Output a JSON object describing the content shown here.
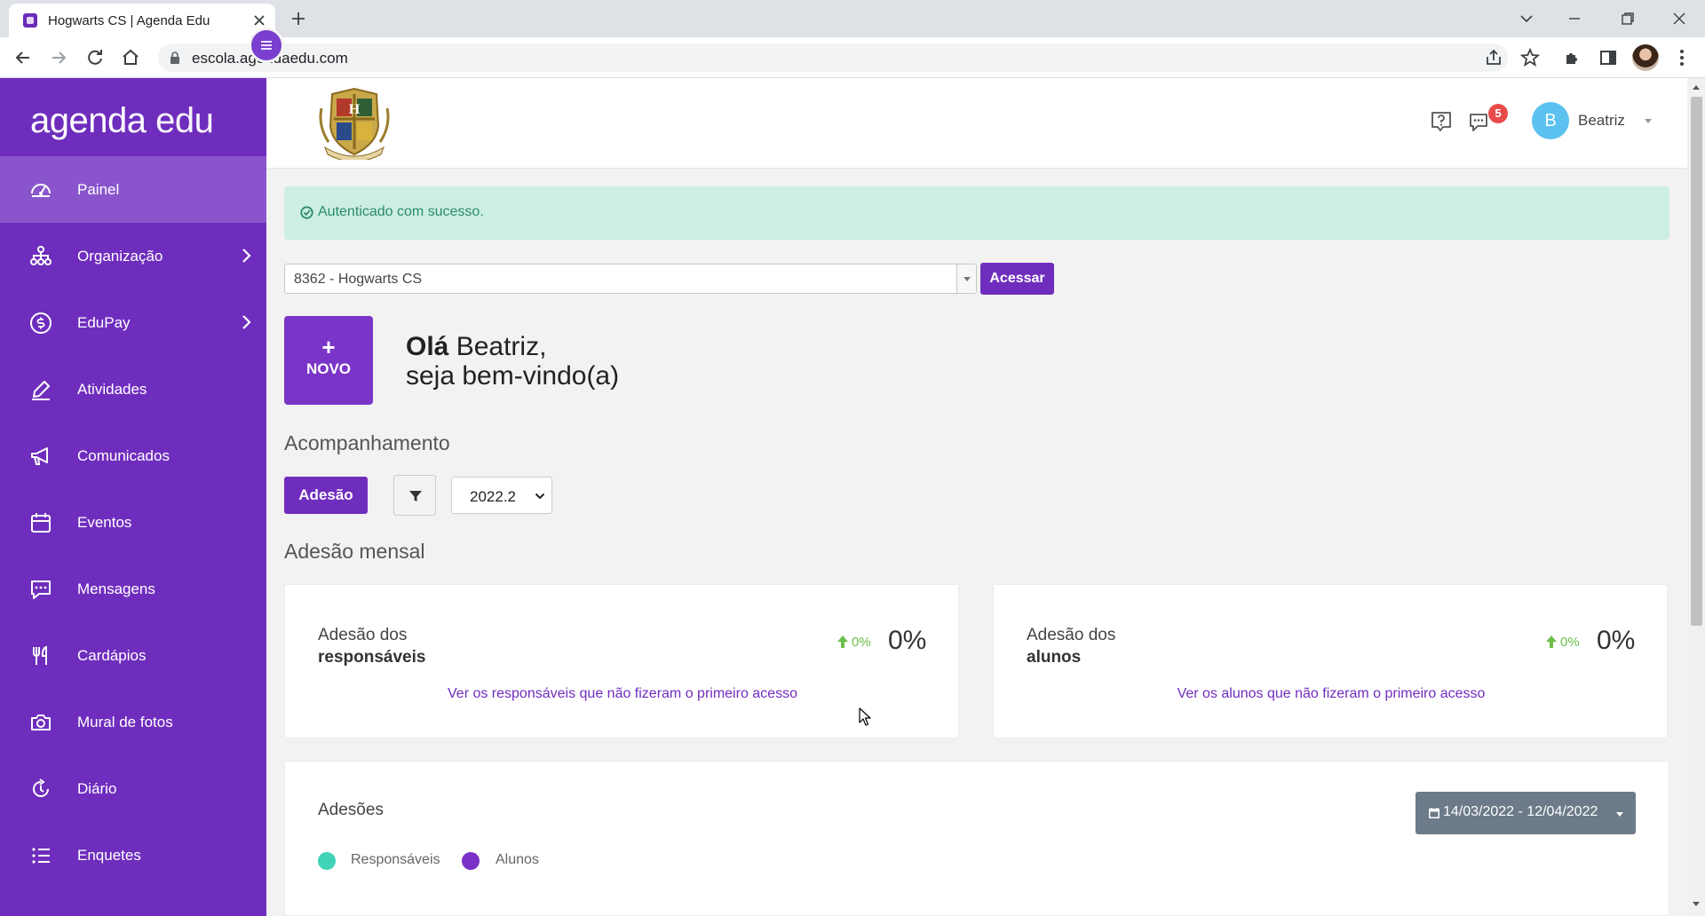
{
  "browser": {
    "tab_title": "Hogwarts CS | Agenda Edu",
    "url": "escola.agendaedu.com"
  },
  "sidebar": {
    "logo_part1": "agenda",
    "logo_part2": " edu",
    "items": [
      {
        "label": "Painel",
        "icon": "dashboard-icon",
        "active": true
      },
      {
        "label": "Organização",
        "icon": "organization-icon",
        "has_submenu": true
      },
      {
        "label": "EduPay",
        "icon": "dollar-icon",
        "has_submenu": true
      },
      {
        "label": "Atividades",
        "icon": "pencil-icon"
      },
      {
        "label": "Comunicados",
        "icon": "megaphone-icon"
      },
      {
        "label": "Eventos",
        "icon": "calendar-icon"
      },
      {
        "label": "Mensagens",
        "icon": "chat-icon"
      },
      {
        "label": "Cardápios",
        "icon": "cutlery-icon"
      },
      {
        "label": "Mural de fotos",
        "icon": "camera-icon"
      },
      {
        "label": "Diário",
        "icon": "cycle-icon"
      },
      {
        "label": "Enquetes",
        "icon": "list-icon"
      }
    ]
  },
  "header": {
    "notifications_count": "5",
    "user_initial": "B",
    "user_name": "Beatriz"
  },
  "alert": {
    "text": "Autenticado com sucesso."
  },
  "school": {
    "selected": "8362 - Hogwarts CS",
    "access_label": "Acessar"
  },
  "novo": {
    "plus": "+",
    "label": "NOVO"
  },
  "greeting": {
    "hello": "Olá",
    "name": " Beatriz,",
    "welcome": "seja bem-vindo(a)"
  },
  "tracking": {
    "heading": "Acompanhamento",
    "tab_label": "Adesão",
    "period": "2022.2"
  },
  "monthly": {
    "heading": "Adesão mensal",
    "cards": [
      {
        "title_line1": "Adesão dos",
        "title_line2": "responsáveis",
        "change": "0%",
        "value": "0%",
        "link": "Ver os responsáveis que não fizeram o primeiro acesso"
      },
      {
        "title_line1": "Adesão dos",
        "title_line2": "alunos",
        "change": "0%",
        "value": "0%",
        "link": "Ver os alunos que não fizeram o primeiro acesso"
      }
    ]
  },
  "adhesions": {
    "title": "Adesões",
    "date_range": "14/03/2022 - 12/04/2022",
    "legend": [
      {
        "label": "Responsáveis",
        "color": "#3fd3b8"
      },
      {
        "label": "Alunos",
        "color": "#7a2fc6"
      }
    ]
  },
  "colors": {
    "brand": "#6f2dbd",
    "success_bg": "#cdeee3",
    "success_text": "#2a8a6e",
    "positive": "#6cbf4a",
    "badge": "#e94b4b"
  }
}
